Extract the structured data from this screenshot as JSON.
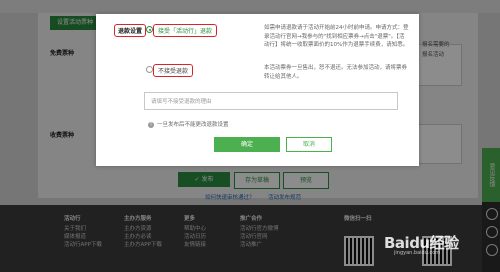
{
  "background": {
    "tab_label": "设置活动票种",
    "free_ticket_label": "免费票种",
    "paid_ticket_label": "收费票种",
    "right_text_1": "报名需要的",
    "right_text_2": "报名活动",
    "buttons": {
      "publish": "发布",
      "save_draft": "存为草稿",
      "preview": "预览"
    },
    "links": {
      "quick_publish": "如何快速审核通过？",
      "publish_rules": "活动发布规范"
    },
    "footer_columns": [
      {
        "heading": "活动行",
        "items": [
          "关于我们",
          "媒体报道",
          "活动行APP下载"
        ]
      },
      {
        "heading": "主办方服务",
        "items": [
          "主办方资源",
          "主办方必读",
          "主办方APP下载"
        ]
      },
      {
        "heading": "更多",
        "items": [
          "帮助中心",
          "活动日历",
          "友情链接"
        ]
      },
      {
        "heading": "推广合作",
        "items": [
          "活动行官方微博",
          "活动行官网",
          "活动推广"
        ]
      },
      {
        "heading": "微信扫一扫",
        "items": []
      }
    ],
    "side_label": "意见反馈"
  },
  "modal": {
    "section_label": "退款设置",
    "option_allow": {
      "label": "接受「活动行」退款",
      "selected": true
    },
    "option_allow_desc": "如需申请退款请于活动开始前24小时前申请。申请方式：登录活动行官网→我参与的\"找到相应票券→点击\"退票\"。【活动行】将统一收取票面价的10%作为退票手续费，请知悉。",
    "option_deny": {
      "label": "不接受退款",
      "selected": false
    },
    "option_deny_desc": "本活动票券一旦售出，恕不退还。无法参加活动，请将票券转让给其他人。",
    "reason_placeholder": "请填写不接受退款的理由",
    "note": "一旦发布后不能更改退款设置",
    "ok_label": "确定",
    "cancel_label": "取消"
  },
  "colors": {
    "accent_green": "#2c8f43",
    "highlight_red": "#d9252a"
  },
  "watermark": {
    "text": "Baidu经验",
    "sub": "jingyan.baidu.com"
  }
}
